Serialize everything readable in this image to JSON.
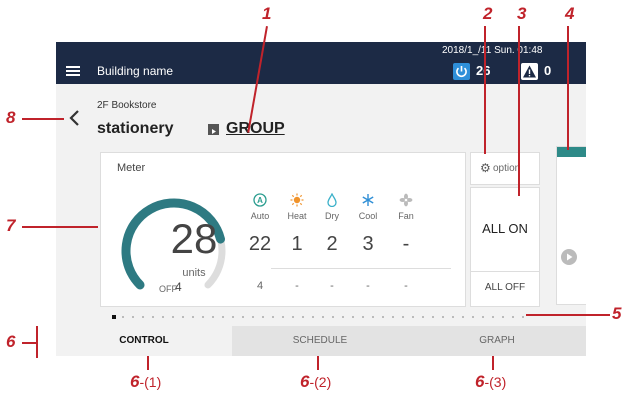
{
  "status_bar": {
    "datetime": "2018/1_/11 Sun. 01:48",
    "building_name": "Building name",
    "on_count": "26",
    "error_count": "0"
  },
  "header": {
    "floor": "2F Bookstore",
    "area": "stationery",
    "group_link": "GROUP"
  },
  "meter": {
    "title": "Meter",
    "units_value": "28",
    "units_label": "units",
    "off_label": "OFF",
    "off_value": "4",
    "gauge_fill": 0.78,
    "modes": [
      {
        "name": "Auto",
        "value": "22",
        "off": "4",
        "icon": "auto-mode-icon",
        "color": "#2a9d8f"
      },
      {
        "name": "Heat",
        "value": "1",
        "off": "-",
        "icon": "heat-sun-icon",
        "color": "#f0932b"
      },
      {
        "name": "Dry",
        "value": "2",
        "off": "-",
        "icon": "dry-drop-icon",
        "color": "#3ab0c9"
      },
      {
        "name": "Cool",
        "value": "3",
        "off": "-",
        "icon": "cool-snowflake-icon",
        "color": "#2f8fd6"
      },
      {
        "name": "Fan",
        "value": "-",
        "off": "-",
        "icon": "fan-icon",
        "color": "#bbbbbb"
      }
    ]
  },
  "side_controls": {
    "option_label": "option",
    "all_on": "ALL ON",
    "all_off": "ALL OFF"
  },
  "tabs": [
    {
      "label": "CONTROL",
      "active": true
    },
    {
      "label": "SCHEDULE",
      "active": false
    },
    {
      "label": "GRAPH",
      "active": false
    }
  ],
  "callouts": {
    "c1": "1",
    "c2": "2",
    "c3": "3",
    "c4": "4",
    "c5": "5",
    "c6": "6",
    "c7": "7",
    "c8": "8",
    "c6_1_num": "6",
    "c6_1_sub": "-(1)",
    "c6_2_num": "6",
    "c6_2_sub": "-(2)",
    "c6_3_num": "6",
    "c6_3_sub": "-(3)"
  },
  "colors": {
    "topbar": "#1c2a45",
    "accent_teal": "#2e8a88",
    "annotation_red": "#c0232b",
    "power_blue": "#2e8fd9"
  }
}
